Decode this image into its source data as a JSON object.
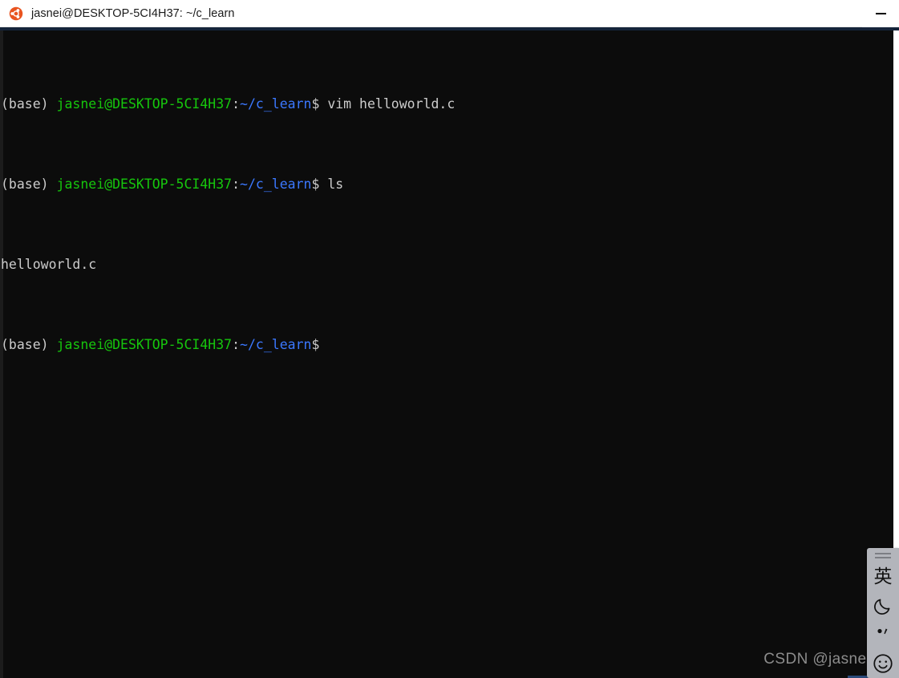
{
  "window": {
    "title": "jasnei@DESKTOP-5CI4H37: ~/c_learn",
    "app_icon": "ubuntu-logo-icon",
    "minimize_label": "—"
  },
  "theme": {
    "titlebar_bg": "#ffffff",
    "titlebar_text": "#1b1b1b",
    "accent_line": "#15243a",
    "terminal_bg": "#0c0c0c",
    "fg_white": "#cccccc",
    "fg_green": "#16c60c",
    "fg_blue": "#3b78ff",
    "ime_bg": "#b3b5bb",
    "watermark": "#8c8c8c"
  },
  "terminal": {
    "prompt": {
      "env": "(base) ",
      "user_host": "jasnei@DESKTOP-5CI4H37",
      "colon": ":",
      "path": "~/c_learn",
      "sigil": "$ "
    },
    "lines": [
      {
        "type": "prompt",
        "env": "(base) ",
        "user_host": "jasnei@DESKTOP-5CI4H37",
        "colon": ":",
        "path": "~/c_learn",
        "sigil": "$ ",
        "command": "vim helloworld.c"
      },
      {
        "type": "prompt",
        "env": "(base) ",
        "user_host": "jasnei@DESKTOP-5CI4H37",
        "colon": ":",
        "path": "~/c_learn",
        "sigil": "$ ",
        "command": "ls"
      },
      {
        "type": "output",
        "text": "helloworld.c"
      },
      {
        "type": "prompt",
        "env": "(base) ",
        "user_host": "jasnei@DESKTOP-5CI4H37",
        "colon": ":",
        "path": "~/c_learn",
        "sigil": "$",
        "command": ""
      }
    ]
  },
  "ime": {
    "handle": "drag-handle-icon",
    "language_mode": "英",
    "moon": "moon-icon",
    "punctuation": "punctuation-icon",
    "smiley": "smiley-icon"
  },
  "watermark": {
    "text": "CSDN @jasneik"
  }
}
